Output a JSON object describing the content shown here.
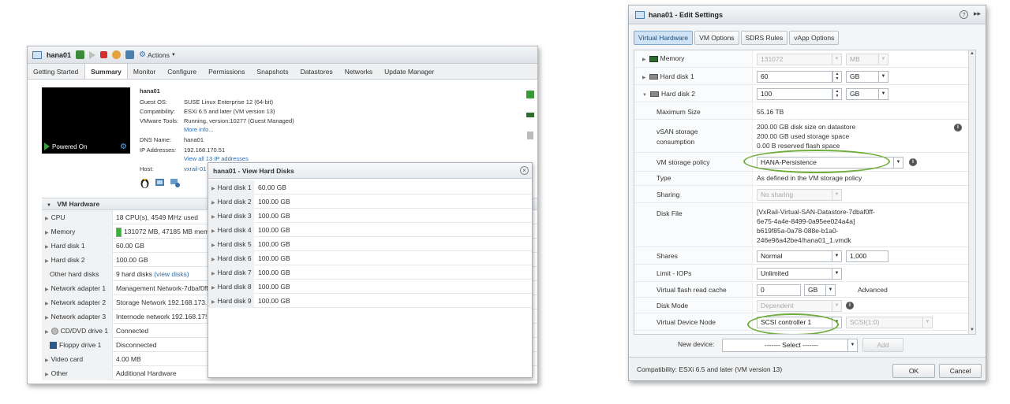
{
  "left": {
    "title": "hana01",
    "actions_label": "Actions",
    "tabs": [
      "Getting Started",
      "Summary",
      "Monitor",
      "Configure",
      "Permissions",
      "Snapshots",
      "Datastores",
      "Networks",
      "Update Manager"
    ],
    "active_tab": "Summary",
    "console_state": "Powered On",
    "summary": {
      "name": "hana01",
      "rows": [
        {
          "key": "Guest OS:",
          "value": "SUSE Linux Enterprise 12 (64-bit)"
        },
        {
          "key": "Compatibility:",
          "value": "ESXi 6.5 and later (VM version 13)"
        },
        {
          "key": "VMware Tools:",
          "value": "Running, version:10277 (Guest Managed)"
        },
        {
          "key": "",
          "value": "More info..."
        },
        {
          "key": "DNS Name:",
          "value": "hana01"
        },
        {
          "key": "IP Addresses:",
          "value": "192.168.170.51"
        },
        {
          "key": "",
          "value": "View all 13 IP addresses"
        },
        {
          "key": "Host:",
          "value": "vxrail-01"
        }
      ]
    },
    "hardware": {
      "header": "VM Hardware",
      "rows": [
        {
          "key": "CPU",
          "value": "18 CPU(s), 4549 MHz used",
          "expand": true
        },
        {
          "key": "Memory",
          "value": "131072 MB, 47185 MB mem",
          "expand": true
        },
        {
          "key": "Hard disk 1",
          "value": "60.00 GB",
          "expand": true
        },
        {
          "key": "Hard disk 2",
          "value": "100.00 GB",
          "expand": true
        },
        {
          "key": "Other hard disks",
          "value": "9 hard disks",
          "link": "(view disks)",
          "expand": false
        },
        {
          "key": "Network adapter 1",
          "value": "Management Network-7dbaf0ff",
          "expand": true,
          "is_link": true
        },
        {
          "key": "Network adapter 2",
          "value": "Storage Network 192.168.173.",
          "expand": true,
          "is_link": true
        },
        {
          "key": "Network adapter 3",
          "value": "Internode network 192.168.17!",
          "expand": true,
          "is_link": true
        },
        {
          "key": "CD/DVD drive 1",
          "value": "Connected",
          "expand": true
        },
        {
          "key": "Floppy drive 1",
          "value": "Disconnected",
          "expand": false
        },
        {
          "key": "Video card",
          "value": "4.00 MB",
          "expand": true
        },
        {
          "key": "Other",
          "value": "Additional Hardware",
          "expand": true
        }
      ]
    },
    "popup": {
      "title": "hana01 - View Hard Disks",
      "disks": [
        {
          "name": "Hard disk 1",
          "size": "60.00 GB"
        },
        {
          "name": "Hard disk 2",
          "size": "100.00 GB"
        },
        {
          "name": "Hard disk 3",
          "size": "100.00 GB"
        },
        {
          "name": "Hard disk 4",
          "size": "100.00 GB"
        },
        {
          "name": "Hard disk 5",
          "size": "100.00 GB"
        },
        {
          "name": "Hard disk 6",
          "size": "100.00 GB"
        },
        {
          "name": "Hard disk 7",
          "size": "100.00 GB"
        },
        {
          "name": "Hard disk 8",
          "size": "100.00 GB"
        },
        {
          "name": "Hard disk 9",
          "size": "100.00 GB"
        }
      ]
    }
  },
  "right": {
    "title": "hana01 - Edit Settings",
    "help": "?",
    "tabs": [
      "Virtual Hardware",
      "VM Options",
      "SDRS Rules",
      "vApp Options"
    ],
    "memory": {
      "label": "Memory",
      "value": "131072",
      "unit": "MB"
    },
    "hd1": {
      "label": "Hard disk 1",
      "value": "60",
      "unit": "GB"
    },
    "hd2": {
      "label": "Hard disk 2",
      "value": "100",
      "unit": "GB"
    },
    "max_size": {
      "label": "Maximum Size",
      "value": "55.16 TB"
    },
    "vsan": {
      "label1": "vSAN storage",
      "label2": "consumption",
      "lines": [
        "200.00 GB disk size on datastore",
        "200.00 GB used storage space",
        "0.00 B reserved flash space"
      ]
    },
    "policy": {
      "label": "VM storage policy",
      "value": "HANA-Persistence"
    },
    "type": {
      "label": "Type",
      "value": "As defined in the VM storage policy"
    },
    "sharing": {
      "label": "Sharing",
      "value": "No sharing"
    },
    "disk_file": {
      "label": "Disk File",
      "lines": [
        "[VxRail-Virtual-SAN-Datastore-7dbaf0ff-",
        "6e75-4a4e-8499-0a95ee024a4a]",
        "b619f85a-0a78-088e-b1a0-",
        "246e96a42be4/hana01_1.vmdk"
      ]
    },
    "shares": {
      "label": "Shares",
      "value": "Normal",
      "num": "1,000"
    },
    "limit": {
      "label": "Limit - IOPs",
      "value": "Unlimited"
    },
    "flash": {
      "label": "Virtual flash read cache",
      "value": "0",
      "unit": "GB",
      "link": "Advanced"
    },
    "disk_mode": {
      "label": "Disk Mode",
      "value": "Dependent"
    },
    "vdn": {
      "label": "Virtual Device Node",
      "value": "SCSI controller 1",
      "value2": "SCSI(1:0)"
    },
    "new_device": {
      "label": "New device:",
      "value": "------- Select -------",
      "add": "Add"
    },
    "footer": {
      "compat": "Compatibility: ESXi 6.5 and later (VM version 13)",
      "ok": "OK",
      "cancel": "Cancel"
    }
  }
}
